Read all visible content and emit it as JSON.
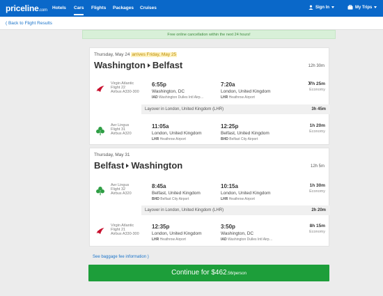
{
  "header": {
    "logo": "priceline",
    "logo_suffix": ".com",
    "nav": [
      "Hotels",
      "Cars",
      "Flights",
      "Packages",
      "Cruises"
    ],
    "active_nav": "Cars",
    "sign_in": "Sign In",
    "my_trips": "My Trips"
  },
  "back_link": "( Back to Flight Results",
  "notice": "Free online cancellation within the next 24 hours!",
  "outbound": {
    "date": "Thursday, May 24",
    "arrives": "arrives Friday, May 25",
    "route_from": "Washington",
    "route_to": "Belfast",
    "total": "12h 30m",
    "segments": [
      {
        "airline": [
          "Virgin Atlantic",
          "Flight 22",
          "Airbus A330-300"
        ],
        "logo": "virgin-atlantic-logo",
        "dep_time": "6:55p",
        "dep_city": "Washington, DC",
        "dep_code": "IAD",
        "dep_airport": "Washington Dulles Intl Airp…",
        "arr_time": "7:20a",
        "arr_city": "London, United Kingdom",
        "arr_code": "LHR",
        "arr_airport": "Heathrow Airport",
        "duration": "7h 25m",
        "cabin": "Economy",
        "overnight_icon": "moon-icon"
      },
      {
        "airline": [
          "Aer Lingus",
          "Flight 31",
          "Airbus A320"
        ],
        "logo": "aer-lingus-shamrock-logo",
        "dep_time": "11:05a",
        "dep_city": "London, United Kingdom",
        "dep_code": "LHR",
        "dep_airport": "Heathrow Airport",
        "arr_time": "12:25p",
        "arr_city": "Belfast, United Kingdom",
        "arr_code": "BHD",
        "arr_airport": "Belfast City Airport",
        "duration": "1h 20m",
        "cabin": "Economy"
      }
    ],
    "layover": {
      "text": "Layover in London, United Kingdom (LHR)",
      "duration": "3h 45m"
    }
  },
  "return": {
    "date": "Thursday, May 31",
    "route_from": "Belfast",
    "route_to": "Washington",
    "total": "12h 5m",
    "segments": [
      {
        "airline": [
          "Aer Lingus",
          "Flight 32",
          "Airbus A320"
        ],
        "logo": "aer-lingus-shamrock-logo",
        "dep_time": "8:45a",
        "dep_city": "Belfast, United Kingdom",
        "dep_code": "BHD",
        "dep_airport": "Belfast City Airport",
        "arr_time": "10:15a",
        "arr_city": "London, United Kingdom",
        "arr_code": "LHR",
        "arr_airport": "Heathrow Airport",
        "duration": "1h 30m",
        "cabin": "Economy"
      },
      {
        "airline": [
          "Virgin Atlantic",
          "Flight 21",
          "Airbus A330-300"
        ],
        "logo": "virgin-atlantic-logo",
        "dep_time": "12:35p",
        "dep_city": "London, United Kingdom",
        "dep_code": "LHR",
        "dep_airport": "Heathrow Airport",
        "arr_time": "3:50p",
        "arr_city": "Washington, DC",
        "arr_code": "IAD",
        "arr_airport": "Washington Dulles Intl Airp…",
        "duration": "8h 15m",
        "cabin": "Economy"
      }
    ],
    "layover": {
      "text": "Layover in London, United Kingdom (LHR)",
      "duration": "2h 20m"
    }
  },
  "baggage_link": "See baggage fee information )",
  "continue": {
    "label": "Continue for $462",
    "cents": ".56/person"
  },
  "colors": {
    "brand_blue": "#0a68c9",
    "cta_green": "#1d9e3a",
    "notice_green": "#3c8a3c",
    "link_blue": "#1a73c9"
  }
}
